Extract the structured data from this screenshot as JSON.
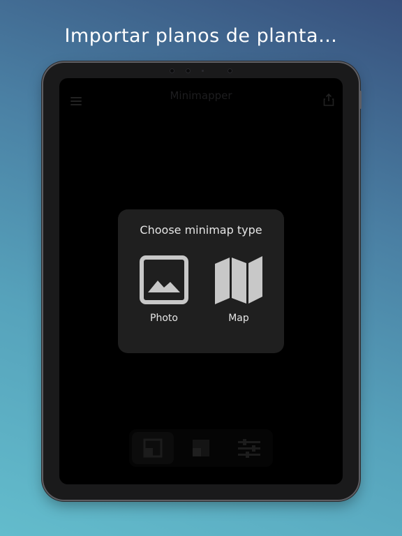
{
  "headline": "Importar planos de planta…",
  "app": {
    "title": "Minimapper"
  },
  "dialog": {
    "title": "Choose minimap type",
    "options": [
      {
        "label": "Photo",
        "icon": "photo-icon"
      },
      {
        "label": "Map",
        "icon": "map-icon"
      }
    ]
  },
  "toolbar": {
    "items": [
      {
        "icon": "square-frame-icon",
        "active": true
      },
      {
        "icon": "square-frame-icon",
        "active": false
      },
      {
        "icon": "sliders-icon",
        "active": false
      }
    ]
  },
  "colors": {
    "dialog_bg": "#1f1f1f",
    "dialog_text": "#e6e6e6",
    "icon_fill": "#c8c8c8",
    "screen_bg": "#000000"
  }
}
